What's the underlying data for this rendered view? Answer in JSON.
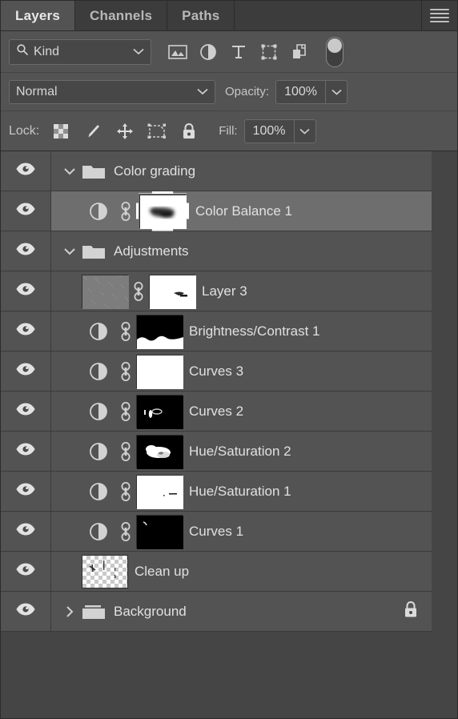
{
  "panel": {
    "tabs": [
      {
        "label": "Layers",
        "active": true
      },
      {
        "label": "Channels",
        "active": false
      },
      {
        "label": "Paths",
        "active": false
      }
    ],
    "menu_icon": "hamburger-menu-icon"
  },
  "filter": {
    "kind_label": "Kind",
    "search_icon": "magnifier-icon",
    "chevron_icon": "chevron-down-icon",
    "icons": [
      "pixel-layer-filter-icon",
      "adjustment-layer-filter-icon",
      "type-layer-filter-icon",
      "shape-layer-filter-icon",
      "smart-object-filter-icon"
    ],
    "toggle": "filter-enable-toggle"
  },
  "blend": {
    "mode": "Normal",
    "opacity_label": "Opacity:",
    "opacity_value": "100%",
    "fill_label": "Fill:",
    "fill_value": "100%"
  },
  "lock": {
    "label": "Lock:",
    "icons": [
      "lock-transparent-pixels-icon",
      "lock-image-pixels-icon",
      "lock-position-icon",
      "lock-artboard-nesting-icon",
      "lock-all-icon"
    ]
  },
  "colors": {
    "panel_bg": "#535353",
    "tab_bg": "#3c3c3c",
    "row_bg": "#535353",
    "row_selected": "#6e6e6e",
    "gutter": "#454545",
    "text": "#e0e0e0",
    "icon": "#cfcfcf"
  },
  "layers": [
    {
      "name": "Color grading",
      "type": "group",
      "expanded": true,
      "visible": true,
      "indent": 0,
      "selected": false,
      "locked": false
    },
    {
      "name": "Color Balance 1",
      "type": "adjustment",
      "visible": true,
      "indent": 1,
      "selected": true,
      "locked": false,
      "has_mask": true,
      "mask_selected": true,
      "mask_style": "white-with-dark-blob",
      "linked": true
    },
    {
      "name": "Adjustments",
      "type": "group",
      "expanded": true,
      "visible": true,
      "indent": 0,
      "selected": false,
      "locked": false
    },
    {
      "name": "Layer 3",
      "type": "pixel",
      "visible": true,
      "indent": 1,
      "selected": false,
      "locked": false,
      "has_mask": true,
      "mask_selected": false,
      "mask_style": "white-with-small-dark-marks",
      "thumb_style": "gray-noise",
      "linked": true
    },
    {
      "name": "Brightness/Contrast 1",
      "type": "adjustment",
      "visible": true,
      "indent": 1,
      "selected": false,
      "locked": false,
      "has_mask": true,
      "mask_selected": false,
      "mask_style": "black-with-white-bottom-band",
      "linked": true
    },
    {
      "name": "Curves 3",
      "type": "adjustment",
      "visible": true,
      "indent": 1,
      "selected": false,
      "locked": false,
      "has_mask": true,
      "mask_selected": false,
      "mask_style": "all-white",
      "linked": true
    },
    {
      "name": "Curves 2",
      "type": "adjustment",
      "visible": true,
      "indent": 1,
      "selected": false,
      "locked": false,
      "has_mask": true,
      "mask_selected": false,
      "mask_style": "black-with-small-white-marks",
      "linked": true
    },
    {
      "name": "Hue/Saturation 2",
      "type": "adjustment",
      "visible": true,
      "indent": 1,
      "selected": false,
      "locked": false,
      "has_mask": true,
      "mask_selected": false,
      "mask_style": "black-with-white-blob",
      "linked": true
    },
    {
      "name": "Hue/Saturation 1",
      "type": "adjustment",
      "visible": true,
      "indent": 1,
      "selected": false,
      "locked": false,
      "has_mask": true,
      "mask_selected": false,
      "mask_style": "white-with-tiny-dark-marks",
      "linked": true
    },
    {
      "name": "Curves 1",
      "type": "adjustment",
      "visible": true,
      "indent": 1,
      "selected": false,
      "locked": false,
      "has_mask": true,
      "mask_selected": false,
      "mask_style": "black-with-tiny-white-mark",
      "linked": true
    },
    {
      "name": "Clean up",
      "type": "pixel",
      "visible": true,
      "indent": 1,
      "selected": false,
      "locked": false,
      "has_mask": false,
      "thumb_style": "transparent-checker",
      "linked": false
    },
    {
      "name": "Background",
      "type": "group",
      "expanded": false,
      "visible": true,
      "indent": 0,
      "selected": false,
      "locked": true
    }
  ],
  "icon_glyphs": {
    "eye": "eye-icon",
    "folder": "folder-icon",
    "chevron_down": "chevron-down-icon",
    "chevron_right": "chevron-right-icon",
    "adjustment": "half-circle-adjustment-icon",
    "link": "mask-link-icon",
    "lock": "padlock-icon"
  }
}
